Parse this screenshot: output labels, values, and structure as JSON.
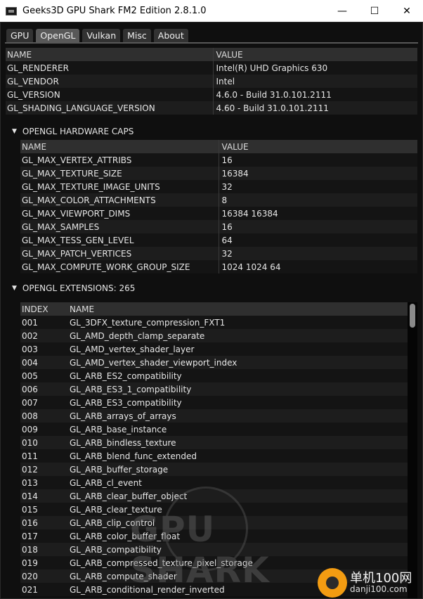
{
  "window": {
    "title": "Geeks3D GPU Shark FM2 Edition 2.8.1.0",
    "minimize": "—",
    "maximize": "☐",
    "close": "✕"
  },
  "tabs": [
    {
      "label": "GPU"
    },
    {
      "label": "OpenGL"
    },
    {
      "label": "Vulkan"
    },
    {
      "label": "Misc"
    },
    {
      "label": "About"
    }
  ],
  "active_tab": "OpenGL",
  "basic": {
    "header": {
      "name": "NAME",
      "value": "VALUE"
    },
    "rows": [
      {
        "name": "GL_RENDERER",
        "value": "Intel(R) UHD Graphics 630"
      },
      {
        "name": "GL_VENDOR",
        "value": "Intel"
      },
      {
        "name": "GL_VERSION",
        "value": "4.6.0 - Build 31.0.101.2111"
      },
      {
        "name": "GL_SHADING_LANGUAGE_VERSION",
        "value": "4.60 - Build 31.0.101.2111"
      }
    ]
  },
  "hw_caps": {
    "title": "OPENGL HARDWARE CAPS",
    "arrow": "▼",
    "header": {
      "name": "NAME",
      "value": "VALUE"
    },
    "rows": [
      {
        "name": "GL_MAX_VERTEX_ATTRIBS",
        "value": "16"
      },
      {
        "name": "GL_MAX_TEXTURE_SIZE",
        "value": "16384"
      },
      {
        "name": "GL_MAX_TEXTURE_IMAGE_UNITS",
        "value": "32"
      },
      {
        "name": "GL_MAX_COLOR_ATTACHMENTS",
        "value": "8"
      },
      {
        "name": "GL_MAX_VIEWPORT_DIMS",
        "value": "16384 16384"
      },
      {
        "name": "GL_MAX_SAMPLES",
        "value": "16"
      },
      {
        "name": "GL_MAX_TESS_GEN_LEVEL",
        "value": "64"
      },
      {
        "name": "GL_MAX_PATCH_VERTICES",
        "value": "32"
      },
      {
        "name": "GL_MAX_COMPUTE_WORK_GROUP_SIZE",
        "value": "1024 1024 64"
      }
    ]
  },
  "extensions": {
    "title": "OPENGL EXTENSIONS: 265",
    "arrow": "▼",
    "header": {
      "index": "INDEX",
      "name": "NAME"
    },
    "rows": [
      {
        "index": "001",
        "name": "GL_3DFX_texture_compression_FXT1"
      },
      {
        "index": "002",
        "name": "GL_AMD_depth_clamp_separate"
      },
      {
        "index": "003",
        "name": "GL_AMD_vertex_shader_layer"
      },
      {
        "index": "004",
        "name": "GL_AMD_vertex_shader_viewport_index"
      },
      {
        "index": "005",
        "name": "GL_ARB_ES2_compatibility"
      },
      {
        "index": "006",
        "name": "GL_ARB_ES3_1_compatibility"
      },
      {
        "index": "007",
        "name": "GL_ARB_ES3_compatibility"
      },
      {
        "index": "008",
        "name": "GL_ARB_arrays_of_arrays"
      },
      {
        "index": "009",
        "name": "GL_ARB_base_instance"
      },
      {
        "index": "010",
        "name": "GL_ARB_bindless_texture"
      },
      {
        "index": "011",
        "name": "GL_ARB_blend_func_extended"
      },
      {
        "index": "012",
        "name": "GL_ARB_buffer_storage"
      },
      {
        "index": "013",
        "name": "GL_ARB_cl_event"
      },
      {
        "index": "014",
        "name": "GL_ARB_clear_buffer_object"
      },
      {
        "index": "015",
        "name": "GL_ARB_clear_texture"
      },
      {
        "index": "016",
        "name": "GL_ARB_clip_control"
      },
      {
        "index": "017",
        "name": "GL_ARB_color_buffer_float"
      },
      {
        "index": "018",
        "name": "GL_ARB_compatibility"
      },
      {
        "index": "019",
        "name": "GL_ARB_compressed_texture_pixel_storage"
      },
      {
        "index": "020",
        "name": "GL_ARB_compute_shader"
      },
      {
        "index": "021",
        "name": "GL_ARB_conditional_render_inverted"
      }
    ]
  },
  "watermark": {
    "text": "GPU SHARK"
  },
  "site_badge": {
    "cn": "单机100网",
    "en": "danji100.com"
  }
}
